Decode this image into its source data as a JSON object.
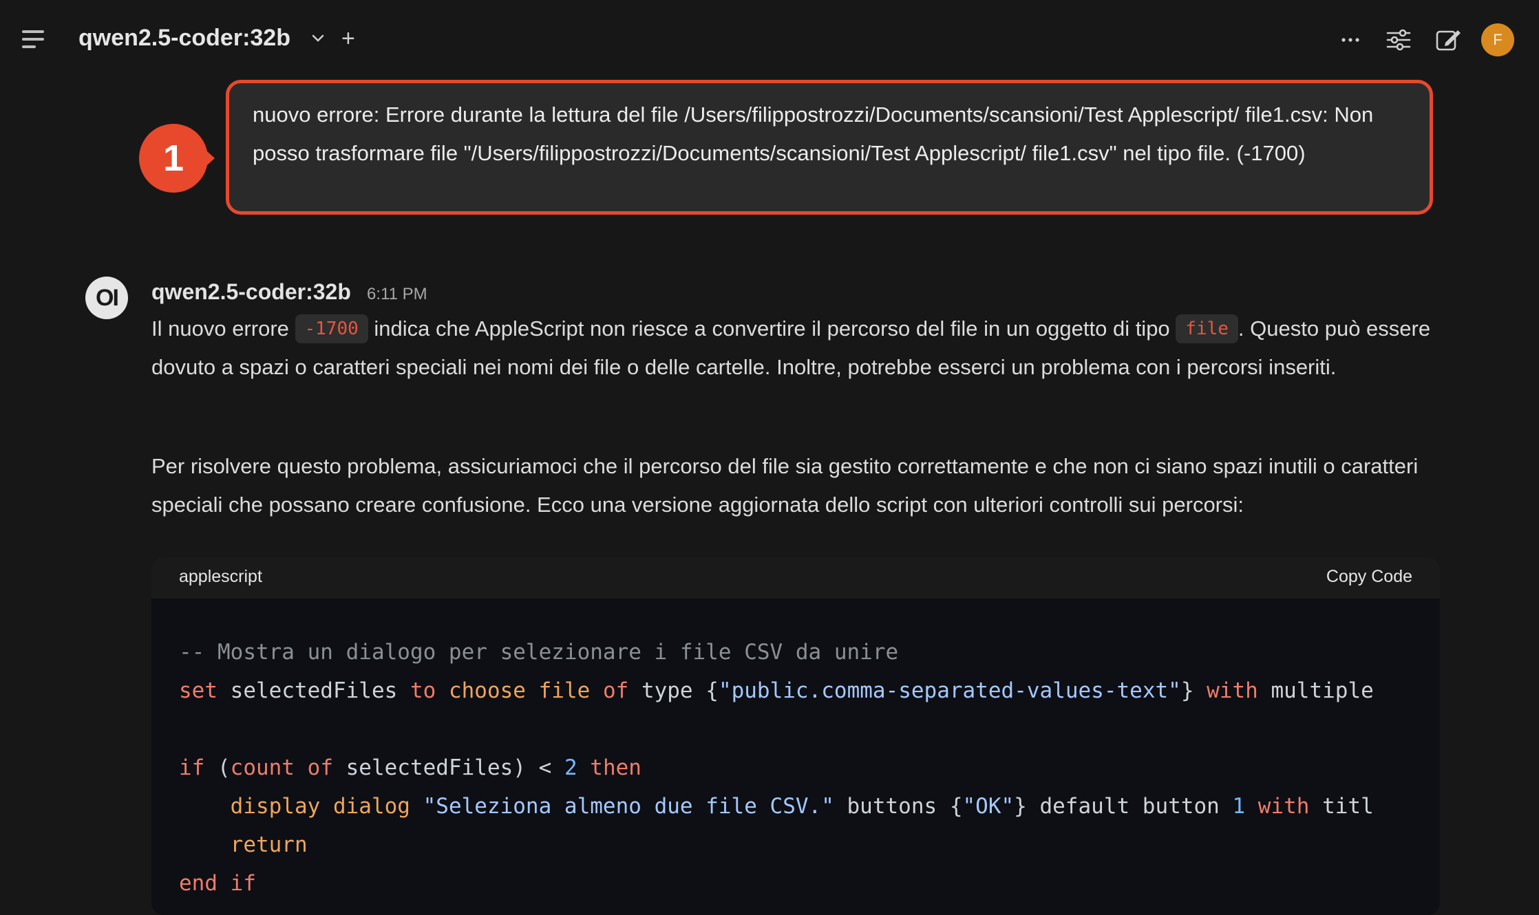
{
  "header": {
    "model_name": "qwen2.5-coder:32b",
    "plus": "+",
    "avatar_initial": "F"
  },
  "user_message": {
    "badge": "1",
    "text": "nuovo errore: Errore durante la lettura del file /Users/filippostrozzi/Documents/scansioni/Test Applescript/ file1.csv: Non posso trasformare file \"/Users/filippostrozzi/Documents/scansioni/Test Applescript/ file1.csv\" nel tipo file. (-1700)"
  },
  "assistant": {
    "avatar": "OI",
    "name": "qwen2.5-coder:32b",
    "time": "6:11 PM",
    "p1_a": "Il nuovo errore ",
    "p1_code1": "-1700",
    "p1_b": " indica che AppleScript non riesce a convertire il percorso del file in un oggetto di tipo ",
    "p1_code2": "file",
    "p1_c": ". Questo può essere dovuto a spazi o caratteri speciali nei nomi dei file o delle cartelle. Inoltre, potrebbe esserci un problema con i percorsi inseriti.",
    "p2": "Per risolvere questo problema, assicuriamoci che il percorso del file sia gestito correttamente e che non ci siano spazi inutili o caratteri speciali che possano creare confusione. Ecco una versione aggiornata dello script con ulteriori controlli sui percorsi:"
  },
  "code_block": {
    "language": "applescript",
    "copy_label": "Copy Code",
    "lines": {
      "l1_comment": "-- Mostra un dialogo per selezionare i file CSV da unire",
      "l2_set": "set",
      "l2_a": " selectedFiles ",
      "l2_to": "to",
      "l2_sp1": " ",
      "l2_choose": "choose file",
      "l2_sp2": " ",
      "l2_of": "of",
      "l2_b": " type {",
      "l2_str": "\"public.comma-separated-values-text\"",
      "l2_c": "} ",
      "l2_with": "with",
      "l2_d": " multiple",
      "l4_if": "if",
      "l4_a": " (",
      "l4_count": "count",
      "l4_sp": " ",
      "l4_of": "of",
      "l4_b": " selectedFiles) < ",
      "l4_num": "2",
      "l4_sp2": " ",
      "l4_then": "then",
      "l5_indent": "    ",
      "l5_display": "display dialog",
      "l5_sp": " ",
      "l5_str": "\"Seleziona almeno due file CSV.\"",
      "l5_a": " buttons {",
      "l5_str2": "\"OK\"",
      "l5_b": "} default button ",
      "l5_num": "1",
      "l5_sp2": " ",
      "l5_with": "with",
      "l5_c": " titl",
      "l6_indent": "    ",
      "l6_return": "return",
      "l7_end": "end if"
    }
  },
  "colors": {
    "background": "#171717",
    "highlight_border": "#e8482c",
    "avatar": "#d98a1e"
  }
}
